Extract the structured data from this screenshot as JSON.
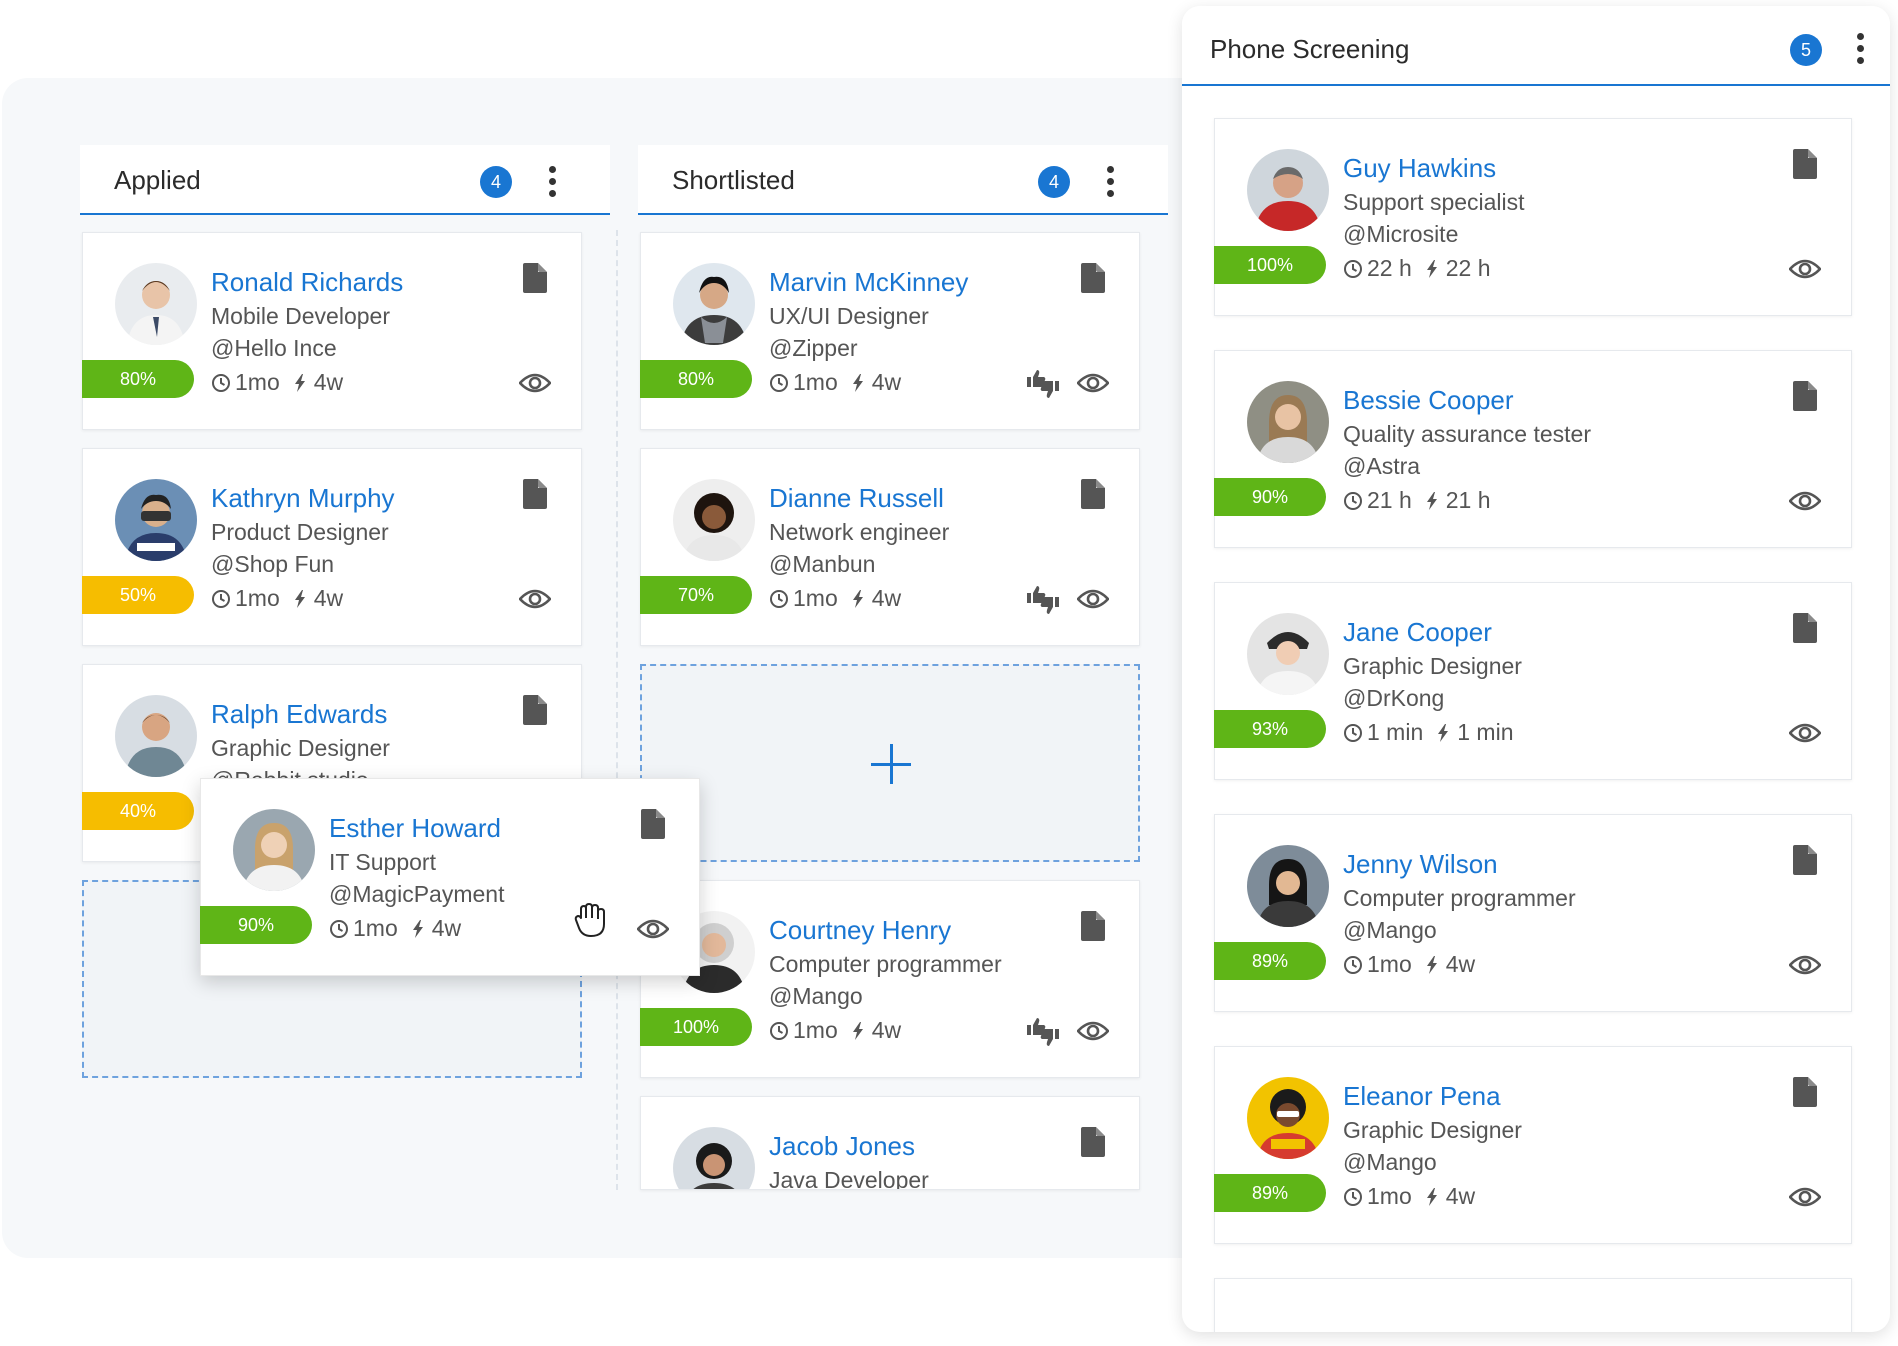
{
  "colors": {
    "accent": "#1976d2",
    "green": "#5fb517",
    "yellow": "#f6bd00",
    "text_link": "#1976d2",
    "text_muted": "#555555"
  },
  "columns": [
    {
      "title": "Applied",
      "count": "4",
      "cards": [
        {
          "name": "Ronald Richards",
          "role": "Mobile Developer",
          "company": "@Hello Ince",
          "pct": "80%",
          "pct_color": "green",
          "time": "1mo",
          "activity": "4w"
        },
        {
          "name": "Kathryn Murphy",
          "role": "Product Designer",
          "company": "@Shop Fun",
          "pct": "50%",
          "pct_color": "yellow",
          "time": "1mo",
          "activity": "4w"
        },
        {
          "name": "Ralph Edwards",
          "role": "Graphic Designer",
          "company": "@Rabbit studio",
          "pct": "40%",
          "pct_color": "yellow",
          "time": "",
          "activity": ""
        }
      ]
    },
    {
      "title": "Shortlisted",
      "count": "4",
      "cards": [
        {
          "name": "Marvin McKinney",
          "role": "UX/UI Designer",
          "company": "@Zipper",
          "pct": "80%",
          "pct_color": "green",
          "time": "1mo",
          "activity": "4w"
        },
        {
          "name": "Dianne Russell",
          "role": "Network engineer",
          "company": "@Manbun",
          "pct": "70%",
          "pct_color": "green",
          "time": "1mo",
          "activity": "4w"
        },
        {
          "name": "Courtney Henry",
          "role": "Computer programmer",
          "company": "@Mango",
          "pct": "100%",
          "pct_color": "green",
          "time": "1mo",
          "activity": "4w"
        },
        {
          "name": "Jacob Jones",
          "role": "Java Developer",
          "company": "",
          "pct": "",
          "pct_color": "green",
          "time": "",
          "activity": ""
        }
      ]
    }
  ],
  "dragging_card": {
    "name": "Esther Howard",
    "role": "IT Support",
    "company": "@MagicPayment",
    "pct": "90%",
    "pct_color": "green",
    "time": "1mo",
    "activity": "4w"
  },
  "panel": {
    "title": "Phone Screening",
    "count": "5",
    "cards": [
      {
        "name": "Guy Hawkins",
        "role": "Support specialist",
        "company": "@Microsite",
        "pct": "100%",
        "pct_color": "green",
        "time": "22 h",
        "activity": "22 h"
      },
      {
        "name": "Bessie Cooper",
        "role": "Quality assurance tester",
        "company": "@Astra",
        "pct": "90%",
        "pct_color": "green",
        "time": "21 h",
        "activity": "21 h"
      },
      {
        "name": "Jane Cooper",
        "role": "Graphic Designer",
        "company": "@DrKong",
        "pct": "93%",
        "pct_color": "green",
        "time": "1 min",
        "activity": "1 min"
      },
      {
        "name": "Jenny Wilson",
        "role": "Computer programmer",
        "company": "@Mango",
        "pct": "89%",
        "pct_color": "green",
        "time": "1mo",
        "activity": "4w"
      },
      {
        "name": "Eleanor Pena",
        "role": "Graphic Designer",
        "company": "@Mango",
        "pct": "89%",
        "pct_color": "green",
        "time": "1mo",
        "activity": "4w"
      }
    ]
  }
}
